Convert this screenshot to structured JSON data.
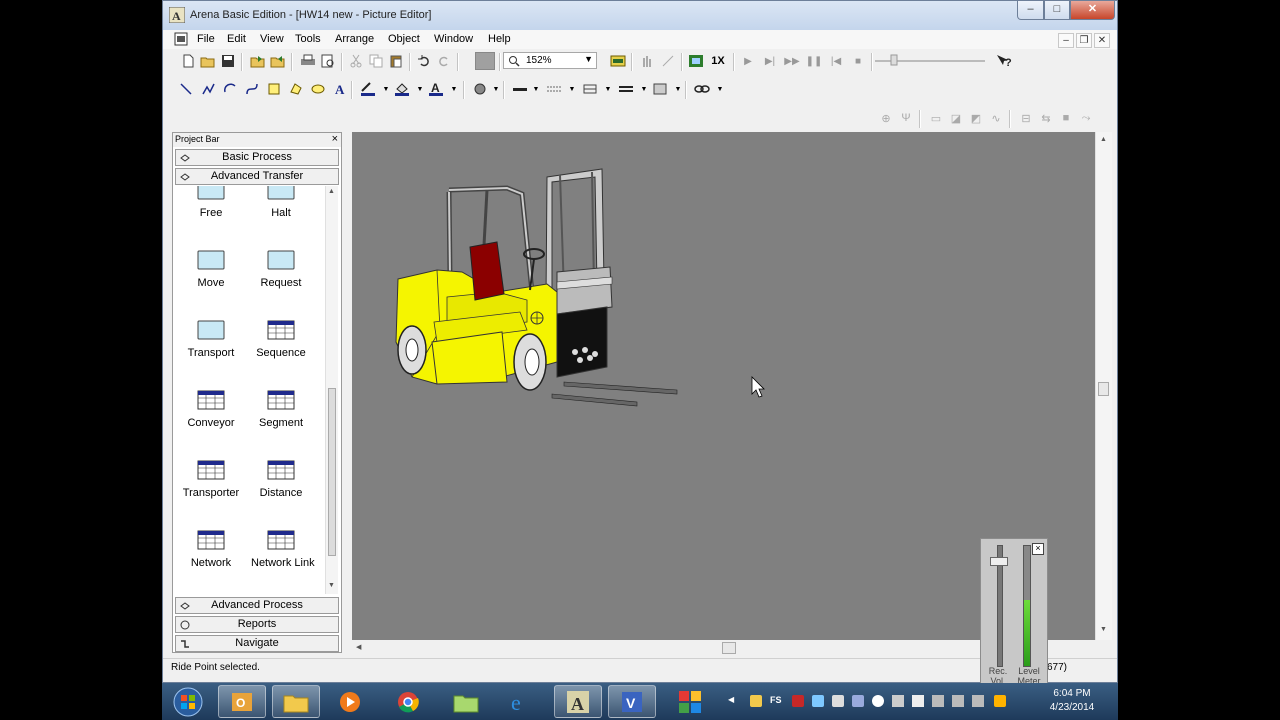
{
  "window": {
    "title": "Arena Basic Edition - [HW14 new - Picture Editor]",
    "controls": {
      "minimize": "–",
      "maximize": "□",
      "close": "✕"
    }
  },
  "menubar": {
    "items": [
      "File",
      "Edit",
      "View",
      "Tools",
      "Arrange",
      "Object",
      "Window",
      "Help"
    ],
    "mdi_controls": {
      "minimize": "–",
      "restore": "❐",
      "close": "✕"
    }
  },
  "toolbar": {
    "zoom_value": "152%",
    "speed_label": "1X"
  },
  "project_bar": {
    "title": "Project Bar",
    "close_glyph": "×",
    "panels_top": [
      {
        "label": "Basic Process"
      },
      {
        "label": "Advanced Transfer"
      }
    ],
    "modules": [
      {
        "label": "Free",
        "kind": "box"
      },
      {
        "label": "Halt",
        "kind": "box"
      },
      {
        "label": "Move",
        "kind": "box"
      },
      {
        "label": "Request",
        "kind": "box"
      },
      {
        "label": "Transport",
        "kind": "box"
      },
      {
        "label": "Sequence",
        "kind": "grid"
      },
      {
        "label": "Conveyor",
        "kind": "grid"
      },
      {
        "label": "Segment",
        "kind": "grid"
      },
      {
        "label": "Transporter",
        "kind": "grid"
      },
      {
        "label": "Distance",
        "kind": "grid"
      },
      {
        "label": "Network",
        "kind": "grid"
      },
      {
        "label": "Network Link",
        "kind": "grid"
      }
    ],
    "panels_bottom": [
      {
        "label": "Advanced Process"
      },
      {
        "label": "Reports"
      },
      {
        "label": "Navigate"
      }
    ]
  },
  "statusbar": {
    "message": "Ride Point selected.",
    "coordinates": "677)"
  },
  "mixer": {
    "rec_label": "Rec. Vol.",
    "level_label": "Level Meter",
    "close_glyph": "×",
    "level_fraction": 0.55
  },
  "taskbar": {
    "time": "6:04 PM",
    "date": "4/23/2014"
  },
  "colors": {
    "canvas": "#808080",
    "forklift_body": "#f5f500",
    "forklift_seat": "#8b0000",
    "module_fill": "#c9e9f5",
    "grid_header": "#1f2a8c"
  }
}
